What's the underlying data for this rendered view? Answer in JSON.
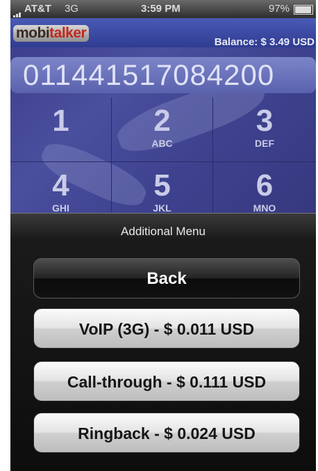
{
  "status_bar": {
    "carrier": "AT&T",
    "network": "3G",
    "time": "3:59 PM",
    "battery": "97%"
  },
  "header": {
    "logo_mobi": "mobi",
    "logo_talker": "talker",
    "balance": "Balance:  $ 3.49 USD"
  },
  "dialed_number": "011441517084200",
  "keypad": [
    {
      "digit": "1",
      "letters": ""
    },
    {
      "digit": "2",
      "letters": "ABC"
    },
    {
      "digit": "3",
      "letters": "DEF"
    },
    {
      "digit": "4",
      "letters": "GHI"
    },
    {
      "digit": "5",
      "letters": "JKL"
    },
    {
      "digit": "6",
      "letters": "MNO"
    }
  ],
  "menu": {
    "title": "Additional Menu",
    "back_label": "Back",
    "voip_label": "VoIP (3G) - $ 0.011 USD",
    "callthrough_label": "Call-through - $ 0.111 USD",
    "ringback_label": "Ringback - $ 0.024 USD"
  },
  "colors": {
    "dialer_bg": "#3f4390",
    "sheet_bg": "#0d0d0d",
    "logo_accent": "#c0281c"
  },
  "icons": [
    "signal-icon",
    "battery-icon"
  ]
}
